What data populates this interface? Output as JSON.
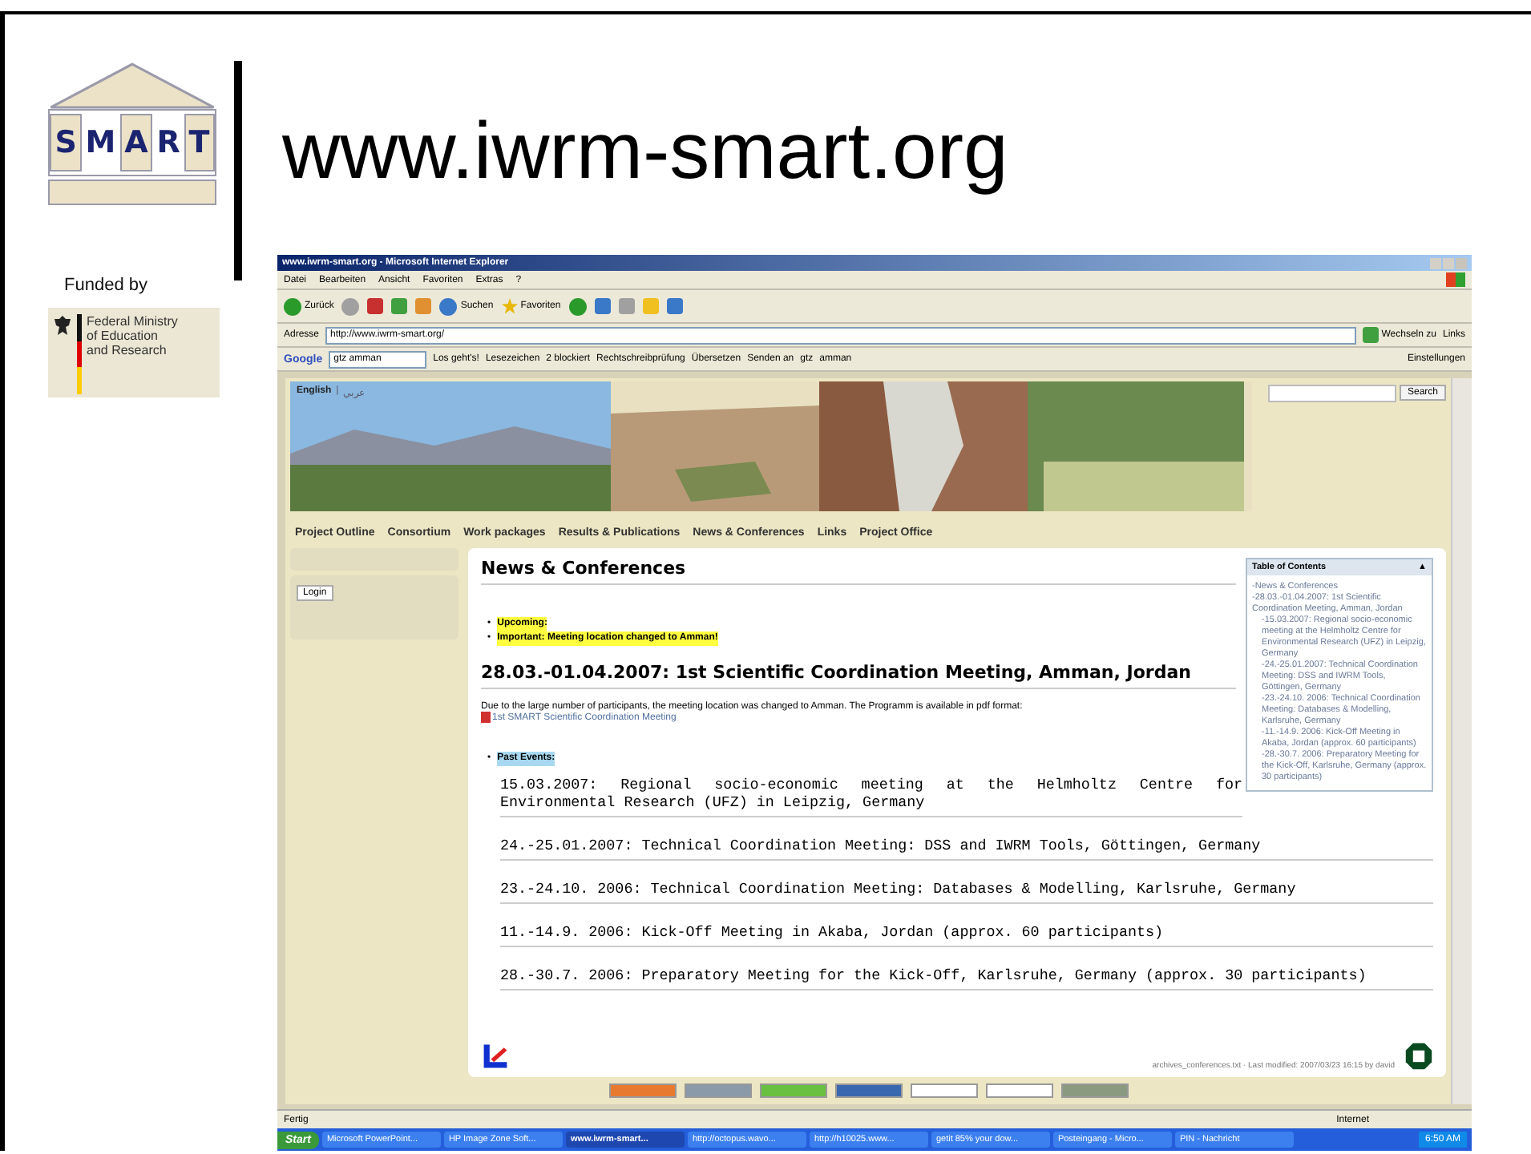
{
  "slide": {
    "logo_letters": [
      "S",
      "M",
      "A",
      "R",
      "T"
    ],
    "title": "www.iwrm-smart.org",
    "funded_by": "Funded by",
    "ministry_lines": [
      "Federal Ministry",
      "of Education",
      "and Research"
    ]
  },
  "browser": {
    "title": "www.iwrm-smart.org - Microsoft Internet Explorer",
    "menu": [
      "Datei",
      "Bearbeiten",
      "Ansicht",
      "Favoriten",
      "Extras",
      "?"
    ],
    "toolbar": [
      "Zurück",
      "Suchen",
      "Favoriten"
    ],
    "address_label": "Adresse",
    "address": "http://www.iwrm-smart.org/",
    "go": "Wechseln zu",
    "links": "Links",
    "google": {
      "logo": "Google",
      "query": "gtz amman",
      "go": "Los geht's!",
      "items": [
        "Lesezeichen",
        "2 blockiert",
        "Rechtschreibprüfung",
        "Übersetzen",
        "Senden an",
        "gtz",
        "amman"
      ],
      "settings": "Einstellungen"
    },
    "page": {
      "languages": [
        "English",
        "|",
        "عربي"
      ],
      "search_button": "Search",
      "nav": [
        "Project Outline",
        "Consortium",
        "Work packages",
        "Results & Publications",
        "News & Conferences",
        "Links",
        "Project Office"
      ],
      "login": "Login",
      "heading": "News & Conferences",
      "notices": [
        "Upcoming:",
        "Important: Meeting location changed to Amman!"
      ],
      "meeting_title": "28.03.-01.04.2007: 1st Scientific Coordination Meeting, Amman, Jordan",
      "paragraph": "Due to the large number of participants, the meeting location was changed to Amman. The Programm is available in pdf format:",
      "pdf_link": "1st SMART Scientific Coordination Meeting",
      "past_label": "Past Events:",
      "events": [
        "15.03.2007: Regional socio-economic meeting at the Helmholtz Centre for Environmental Research (UFZ) in Leipzig, Germany",
        "24.-25.01.2007: Technical Coordination Meeting: DSS and IWRM Tools, Göttingen, Germany",
        "23.-24.10. 2006: Technical Coordination Meeting: Databases & Modelling, Karlsruhe, Germany",
        "11.-14.9. 2006: Kick-Off Meeting in Akaba, Jordan (approx. 60 participants)",
        "28.-30.7. 2006: Preparatory Meeting for the Kick-Off, Karlsruhe, Germany (approx. 30 participants)"
      ],
      "bullet": "•",
      "toc": {
        "title": "Table of Contents",
        "toggle": "▲",
        "items": [
          {
            "label": "-News & Conferences"
          },
          {
            "label": "-28.03.-01.04.2007: 1st Scientific Coordination Meeting, Amman, Jordan",
            "children": [
              {
                "label": "-15.03.2007: Regional socio-economic meeting at the Helmholtz Centre for Environmental Research (UFZ) in Leipzig, Germany"
              },
              {
                "label": "-24.-25.01.2007: Technical Coordination Meeting: DSS and IWRM Tools, Göttingen, Germany"
              },
              {
                "label": "-23.-24.10. 2006: Technical Coordination Meeting: Databases & Modelling, Karlsruhe, Germany"
              },
              {
                "label": "-11.-14.9. 2006: Kick-Off Meeting in Akaba, Jordan (approx. 60 participants)"
              },
              {
                "label": "-28.-30.7. 2006: Preparatory Meeting for the Kick-Off, Karlsruhe, Germany (approx. 30 participants)"
              }
            ]
          }
        ]
      },
      "footer": "archives_conferences.txt · Last modified: 2007/03/23 16:15 by david"
    },
    "status": {
      "text": "Fertig",
      "zone": "Internet"
    },
    "taskbar": {
      "start": "Start",
      "items": [
        {
          "label": "Microsoft PowerPoint...",
          "selected": false
        },
        {
          "label": "HP Image Zone Soft...",
          "selected": false
        },
        {
          "label": "www.iwrm-smart...",
          "selected": true
        },
        {
          "label": "http://octopus.wavo...",
          "selected": false
        },
        {
          "label": "http://h10025.www...",
          "selected": false
        },
        {
          "label": "getit 85% your dow...",
          "selected": false
        },
        {
          "label": "Posteingang - Micro...",
          "selected": false
        },
        {
          "label": "PIN - Nachricht",
          "selected": false
        }
      ],
      "clock": "6:50 AM"
    }
  }
}
